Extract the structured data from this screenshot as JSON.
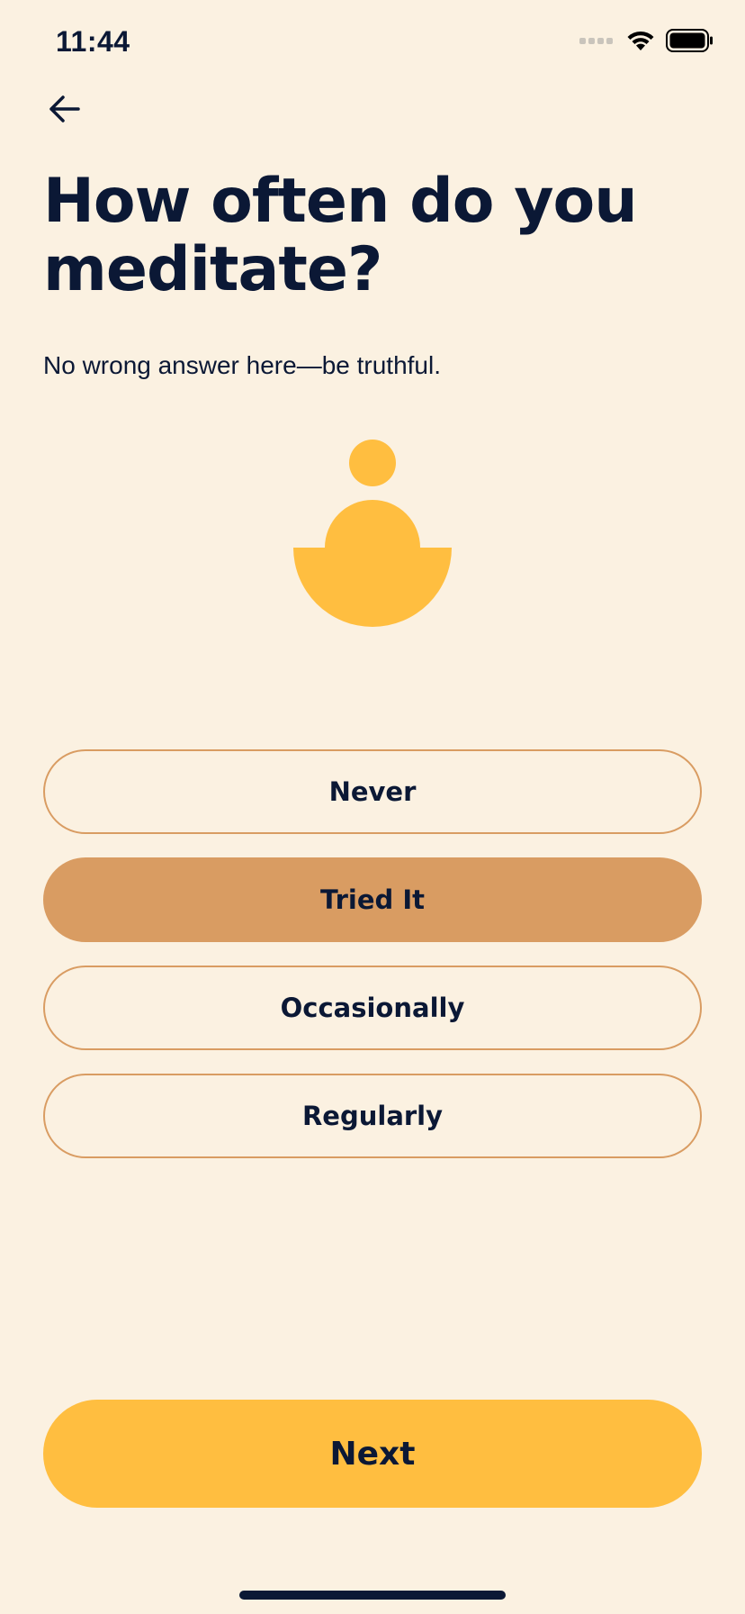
{
  "status_bar": {
    "time": "11:44",
    "icons": [
      "signal-icon",
      "wifi-icon",
      "battery-icon"
    ]
  },
  "header": {
    "back_icon": "arrow-left-icon"
  },
  "main": {
    "title": "How often do you meditate?",
    "subtitle": "No wrong answer here—be truthful.",
    "illustration": "meditating-figure-icon"
  },
  "options": [
    {
      "label": "Never",
      "selected": false
    },
    {
      "label": "Tried It",
      "selected": true
    },
    {
      "label": "Occasionally",
      "selected": false
    },
    {
      "label": "Regularly",
      "selected": false
    }
  ],
  "footer": {
    "next_label": "Next"
  },
  "colors": {
    "background": "#FBF1E1",
    "text": "#0B1835",
    "accent_yellow": "#FFBE40",
    "option_border": "#D99C62",
    "option_selected": "#D99C62"
  }
}
